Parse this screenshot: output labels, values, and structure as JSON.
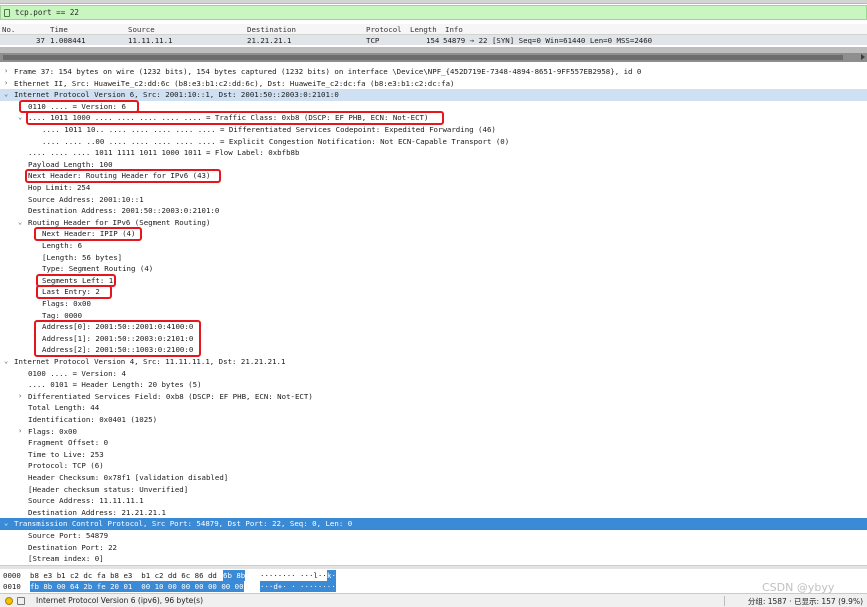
{
  "filter": {
    "expression": "tcp.port == 22"
  },
  "packet_list": {
    "columns": [
      "No.",
      "Time",
      "Source",
      "Destination",
      "Protocol",
      "Length",
      "Info"
    ],
    "rows": [
      {
        "no": "37",
        "time": "1.008441",
        "source": "11.11.11.1",
        "destination": "21.21.21.1",
        "protocol": "TCP",
        "length": "154",
        "info": "54879 → 22 [SYN] Seq=0 Win=61440 Len=0 MSS=2460"
      }
    ]
  },
  "details": [
    {
      "arrow": "›",
      "text": "Frame 37: 154 bytes on wire (1232 bits), 154 bytes captured (1232 bits) on interface \\Device\\NPF_{452D719E-7348-4894-8651-9FF557EB2958}, id 0"
    },
    {
      "arrow": "›",
      "text": "Ethernet II, Src: HuaweiTe_c2:dd:6c (b8:e3:b1:c2:dd:6c), Dst: HuaweiTe_c2:dc:fa (b8:e3:b1:c2:dc:fa)"
    },
    {
      "arrow": "⌄",
      "text": "Internet Protocol Version 6, Src: 2001:10::1, Dst: 2001:50::2003:0:2101:0"
    },
    {
      "arrow": "",
      "text": "0110 .... = Version: 6"
    },
    {
      "arrow": "⌄",
      "text": ".... 1011 1000 .... .... .... .... .... = Traffic Class: 0xb8 (DSCP: EF PHB, ECN: Not-ECT)"
    },
    {
      "arrow": "",
      "text": ".... 1011 10.. .... .... .... .... .... = Differentiated Services Codepoint: Expedited Forwarding (46)"
    },
    {
      "arrow": "",
      "text": ".... .... ..00 .... .... .... .... .... = Explicit Congestion Notification: Not ECN-Capable Transport (0)"
    },
    {
      "arrow": "",
      "text": ".... .... .... 1011 1111 1011 1000 1011 = Flow Label: 0xbfb8b"
    },
    {
      "arrow": "",
      "text": "Payload Length: 100"
    },
    {
      "arrow": "",
      "text": "Next Header: Routing Header for IPv6 (43)"
    },
    {
      "arrow": "",
      "text": "Hop Limit: 254"
    },
    {
      "arrow": "",
      "text": "Source Address: 2001:10::1"
    },
    {
      "arrow": "",
      "text": "Destination Address: 2001:50::2003:0:2101:0"
    },
    {
      "arrow": "⌄",
      "text": "Routing Header for IPv6 (Segment Routing)"
    },
    {
      "arrow": "",
      "text": "Next Header: IPIP (4)"
    },
    {
      "arrow": "",
      "text": "Length: 6"
    },
    {
      "arrow": "",
      "text": "[Length: 56 bytes]"
    },
    {
      "arrow": "",
      "text": "Type: Segment Routing (4)"
    },
    {
      "arrow": "",
      "text": "Segments Left: 1"
    },
    {
      "arrow": "",
      "text": "Last Entry: 2"
    },
    {
      "arrow": "",
      "text": "Flags: 0x00"
    },
    {
      "arrow": "",
      "text": "Tag: 0000"
    },
    {
      "arrow": "",
      "text": "Address[0]: 2001:50::2001:0:4100:0"
    },
    {
      "arrow": "",
      "text": "Address[1]: 2001:50::2003:0:2101:0"
    },
    {
      "arrow": "",
      "text": "Address[2]: 2001:50::1003:0:2100:0"
    },
    {
      "arrow": "⌄",
      "text": "Internet Protocol Version 4, Src: 11.11.11.1, Dst: 21.21.21.1"
    },
    {
      "arrow": "",
      "text": "0100 .... = Version: 4"
    },
    {
      "arrow": "",
      "text": ".... 0101 = Header Length: 20 bytes (5)"
    },
    {
      "arrow": "›",
      "text": "Differentiated Services Field: 0xb8 (DSCP: EF PHB, ECN: Not-ECT)"
    },
    {
      "arrow": "",
      "text": "Total Length: 44"
    },
    {
      "arrow": "",
      "text": "Identification: 0x0401 (1025)"
    },
    {
      "arrow": "›",
      "text": "Flags: 0x00"
    },
    {
      "arrow": "",
      "text": "Fragment Offset: 0"
    },
    {
      "arrow": "",
      "text": "Time to Live: 253"
    },
    {
      "arrow": "",
      "text": "Protocol: TCP (6)"
    },
    {
      "arrow": "",
      "text": "Header Checksum: 0x78f1 [validation disabled]"
    },
    {
      "arrow": "",
      "text": "[Header checksum status: Unverified]"
    },
    {
      "arrow": "",
      "text": "Source Address: 11.11.11.1"
    },
    {
      "arrow": "",
      "text": "Destination Address: 21.21.21.1"
    },
    {
      "arrow": "⌄",
      "text": "Transmission Control Protocol, Src Port: 54879, Dst Port: 22, Seq: 0, Len: 0"
    },
    {
      "arrow": "",
      "text": "Source Port: 54879"
    },
    {
      "arrow": "",
      "text": "Destination Port: 22"
    },
    {
      "arrow": "",
      "text": "[Stream index: 0]"
    }
  ],
  "hex": [
    {
      "offset": "0000",
      "bytes": "b8 e3 b1 c2 dc fa b8 e3  b1 c2 dd 6c 86 dd",
      "bytes_sel": "6b 8b",
      "ascii": "········ ···l··",
      "ascii_sel": "k·"
    },
    {
      "offset": "0010",
      "bytes": "",
      "bytes_sel": "fb 8b 00 64 2b fe 20 01  00 10 00 00 00 00 00 00",
      "ascii": "",
      "ascii_sel": "···d+· · ········"
    }
  ],
  "status": {
    "message": "Internet Protocol Version 6 (ipv6), 96 byte(s)",
    "stats": "分组: 1587 · 已显示: 157 (9.9%)"
  },
  "watermark": "CSDN @ybyy",
  "colors": {
    "filter_ok": "#c9f5c1",
    "selected": "#3b8ad6",
    "annotation": "#e6161d"
  }
}
